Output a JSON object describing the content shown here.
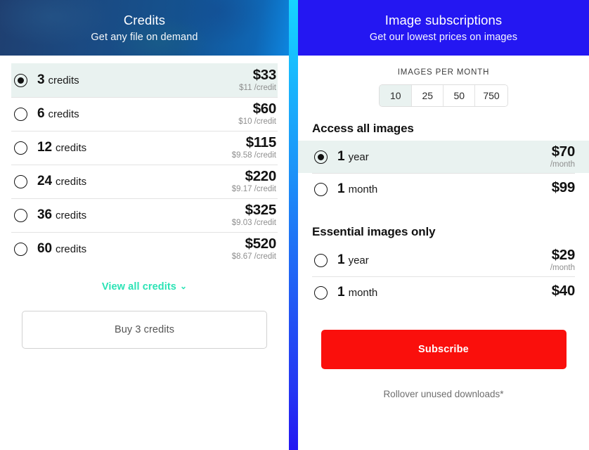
{
  "credits_panel": {
    "header": {
      "title": "Credits",
      "subtitle": "Get any file on demand"
    },
    "options": [
      {
        "qty": "3",
        "unit": "credits",
        "price": "$33",
        "per": "$11 /credit",
        "selected": true
      },
      {
        "qty": "6",
        "unit": "credits",
        "price": "$60",
        "per": "$10 /credit",
        "selected": false
      },
      {
        "qty": "12",
        "unit": "credits",
        "price": "$115",
        "per": "$9.58 /credit",
        "selected": false
      },
      {
        "qty": "24",
        "unit": "credits",
        "price": "$220",
        "per": "$9.17 /credit",
        "selected": false
      },
      {
        "qty": "36",
        "unit": "credits",
        "price": "$325",
        "per": "$9.03 /credit",
        "selected": false
      },
      {
        "qty": "60",
        "unit": "credits",
        "price": "$520",
        "per": "$8.67 /credit",
        "selected": false
      }
    ],
    "view_all_label": "View all credits",
    "view_all_chevron": "chevron-down-icon",
    "view_all_chevron_glyph": "⌄",
    "buy_button_label": "Buy 3 credits"
  },
  "subscriptions_panel": {
    "header": {
      "title": "Image subscriptions",
      "subtitle": "Get our lowest prices on images"
    },
    "images_per_month": {
      "label": "IMAGES PER MONTH",
      "options": [
        "10",
        "25",
        "50",
        "750"
      ],
      "selected": "10"
    },
    "groups": [
      {
        "title": "Access all images",
        "options": [
          {
            "qty": "1",
            "unit": "year",
            "price": "$70",
            "per": "/month",
            "selected": true
          },
          {
            "qty": "1",
            "unit": "month",
            "price": "$99",
            "per": "",
            "selected": false
          }
        ]
      },
      {
        "title": "Essential images only",
        "options": [
          {
            "qty": "1",
            "unit": "year",
            "price": "$29",
            "per": "/month",
            "selected": false
          },
          {
            "qty": "1",
            "unit": "month",
            "price": "$40",
            "per": "",
            "selected": false
          }
        ]
      }
    ],
    "subscribe_button_label": "Subscribe",
    "rollover_note": "Rollover unused downloads*"
  },
  "colors": {
    "credits_header_gradient_start": "#1f3f70",
    "credits_header_gradient_end": "#0d86e0",
    "subscriptions_header": "#2417f2",
    "divider_top": "#16d6ff",
    "divider_bottom": "#2417f2",
    "selected_row_bg": "#e9f2f0",
    "view_all_link": "#2be3b5",
    "subscribe_button_bg": "#fa0f0c",
    "price_text": "#111111",
    "muted_text": "#8e8e8e"
  }
}
